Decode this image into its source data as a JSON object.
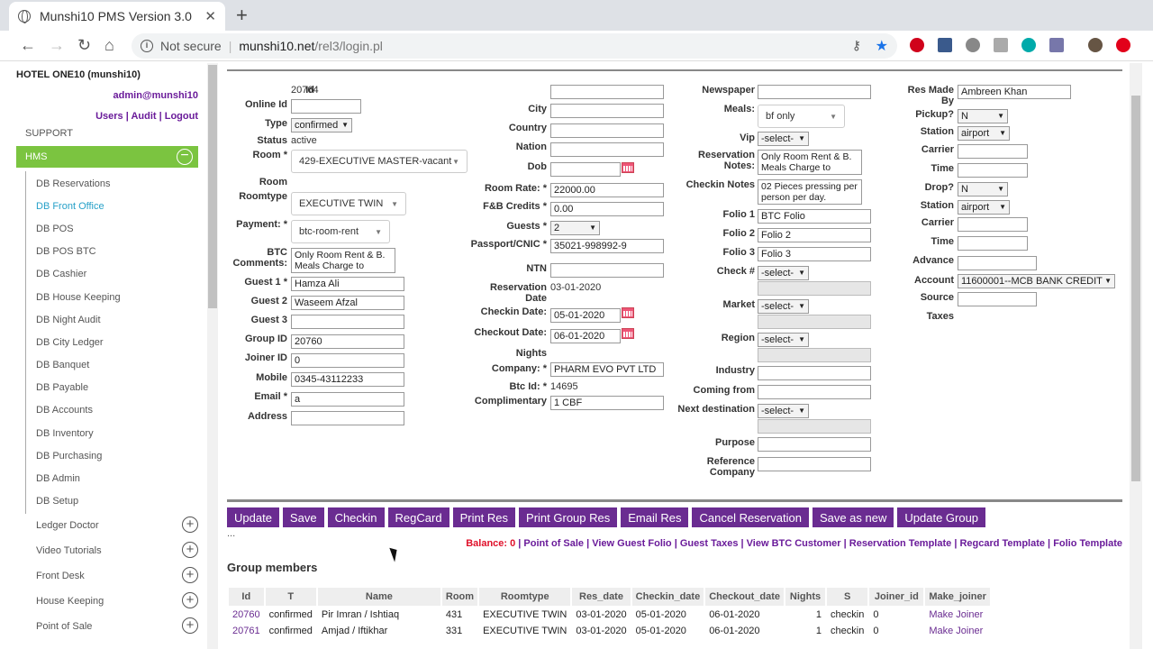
{
  "browser": {
    "tab_title": "Munshi10 PMS Version 3.0",
    "not_secure": "Not secure",
    "url_domain": "munshi10.net",
    "url_path": "/rel3/login.pl"
  },
  "sidebar": {
    "hotel": "HOTEL ONE10 (munshi10)",
    "admin": "admin@munshi10",
    "links": "Users | Audit | Logout",
    "support": "SUPPORT",
    "hms": "HMS",
    "items": [
      "DB Reservations",
      "DB Front Office",
      "DB POS",
      "DB POS BTC",
      "DB Cashier",
      "DB House Keeping",
      "DB Night Audit",
      "DB City Ledger",
      "DB Banquet",
      "DB Payable",
      "DB Accounts",
      "DB Inventory",
      "DB Purchasing",
      "DB Admin",
      "DB Setup"
    ],
    "accordions": [
      "Ledger Doctor",
      "Video Tutorials",
      "Front Desk",
      "House Keeping",
      "Point of Sale"
    ]
  },
  "form": {
    "col1": {
      "id_label": "Id",
      "id": "20764",
      "online_id_label": "Online Id",
      "type_label": "Type",
      "type": "confirmed",
      "status_label": "Status",
      "status": "active",
      "room_label": "Room *",
      "room": "429-EXECUTIVE MASTER-vacant",
      "room2_label": "Room",
      "roomtype_label": "Roomtype",
      "roomtype": "EXECUTIVE TWIN",
      "payment_label": "Payment: *",
      "payment": "btc-room-rent",
      "btc_label": "BTC Comments:",
      "btc": "Only Room Rent & B. Meals Charge to",
      "guest1_label": "Guest 1 *",
      "guest1": "Hamza Ali",
      "guest2_label": "Guest 2",
      "guest2": "Waseem Afzal",
      "guest3_label": "Guest 3",
      "group_label": "Group ID",
      "group": "20760",
      "joiner_label": "Joiner ID",
      "joiner": "0",
      "mobile_label": "Mobile",
      "mobile": "0345-43112233",
      "email_label": "Email *",
      "email": "a",
      "address_label": "Address"
    },
    "col2": {
      "city_label": "City",
      "country_label": "Country",
      "nation_label": "Nation",
      "dob_label": "Dob",
      "rate_label": "Room Rate: *",
      "rate": "22000.00",
      "fb_label": "F&B Credits *",
      "fb": "0.00",
      "guests_label": "Guests *",
      "guests": "2",
      "passport_label": "Passport/CNIC *",
      "passport": "35021-998992-9",
      "ntn_label": "NTN",
      "resdate_label": "Reservation Date",
      "resdate": "03-01-2020",
      "checkin_label": "Checkin Date:",
      "checkin": "05-01-2020",
      "checkout_label": "Checkout Date:",
      "checkout": "06-01-2020",
      "nights_label": "Nights",
      "company_label": "Company: *",
      "company": "PHARM EVO PVT LTD",
      "btcid_label": "Btc Id: *",
      "btcid": "14695",
      "comp_label": "Complimentary",
      "comp": "1 CBF"
    },
    "col3": {
      "news_label": "Newspaper",
      "meals_label": "Meals:",
      "meals": "bf only",
      "vip_label": "Vip",
      "vip": "-select-",
      "resnotes_label": "Reservation Notes:",
      "resnotes": "Only Room Rent & B. Meals Charge to",
      "checkinnotes_label": "Checkin Notes",
      "checkinnotes": "02 Pieces pressing per person per day.",
      "folio1_label": "Folio 1",
      "folio1": "BTC Folio",
      "folio2_label": "Folio 2",
      "folio2": "Folio 2",
      "folio3_label": "Folio 3",
      "folio3": "Folio 3",
      "check_label": "Check #",
      "check": "-select-",
      "market_label": "Market",
      "market": "-select-",
      "region_label": "Region",
      "region": "-select-",
      "industry_label": "Industry",
      "coming_label": "Coming from",
      "next_label": "Next destination",
      "next": "-select-",
      "purpose_label": "Purpose",
      "ref_label": "Reference Company"
    },
    "col4": {
      "resby_label": "Res Made By",
      "resby": "Ambreen Khan",
      "pickup_label": "Pickup?",
      "pickup": "N",
      "station_label": "Station",
      "station": "airport",
      "carrier_label": "Carrier",
      "time_label": "Time",
      "drop_label": "Drop?",
      "drop": "N",
      "station2": "airport",
      "advance_label": "Advance",
      "account_label": "Account",
      "account": "11600001--MCB BANK CREDIT",
      "source_label": "Source",
      "taxes_label": "Taxes"
    }
  },
  "buttons": [
    "Update",
    "Save",
    "Checkin",
    "RegCard",
    "Print Res",
    "Print Group Res",
    "Email Res",
    "Cancel Reservation",
    "Save as new",
    "Update Group"
  ],
  "dots": "...",
  "links": {
    "balance": "Balance: 0",
    "rest": " | Point of Sale | View Guest Folio | Guest Taxes | View BTC Customer | Reservation Template | Regcard Template | Folio Template"
  },
  "group": {
    "title": "Group members",
    "headers": [
      "Id",
      "T",
      "Name",
      "Room",
      "Roomtype",
      "Res_date",
      "Checkin_date",
      "Checkout_date",
      "Nights",
      "S",
      "Joiner_id",
      "Make_joiner"
    ],
    "rows": [
      [
        "20760",
        "confirmed",
        "Pir Imran / Ishtiaq",
        "431",
        "EXECUTIVE TWIN",
        "03-01-2020",
        "05-01-2020",
        "06-01-2020",
        "1",
        "checkin",
        "0",
        "Make Joiner"
      ],
      [
        "20761",
        "confirmed",
        "Amjad / Iftikhar",
        "331",
        "EXECUTIVE TWIN",
        "03-01-2020",
        "05-01-2020",
        "06-01-2020",
        "1",
        "checkin",
        "0",
        "Make Joiner"
      ]
    ]
  }
}
